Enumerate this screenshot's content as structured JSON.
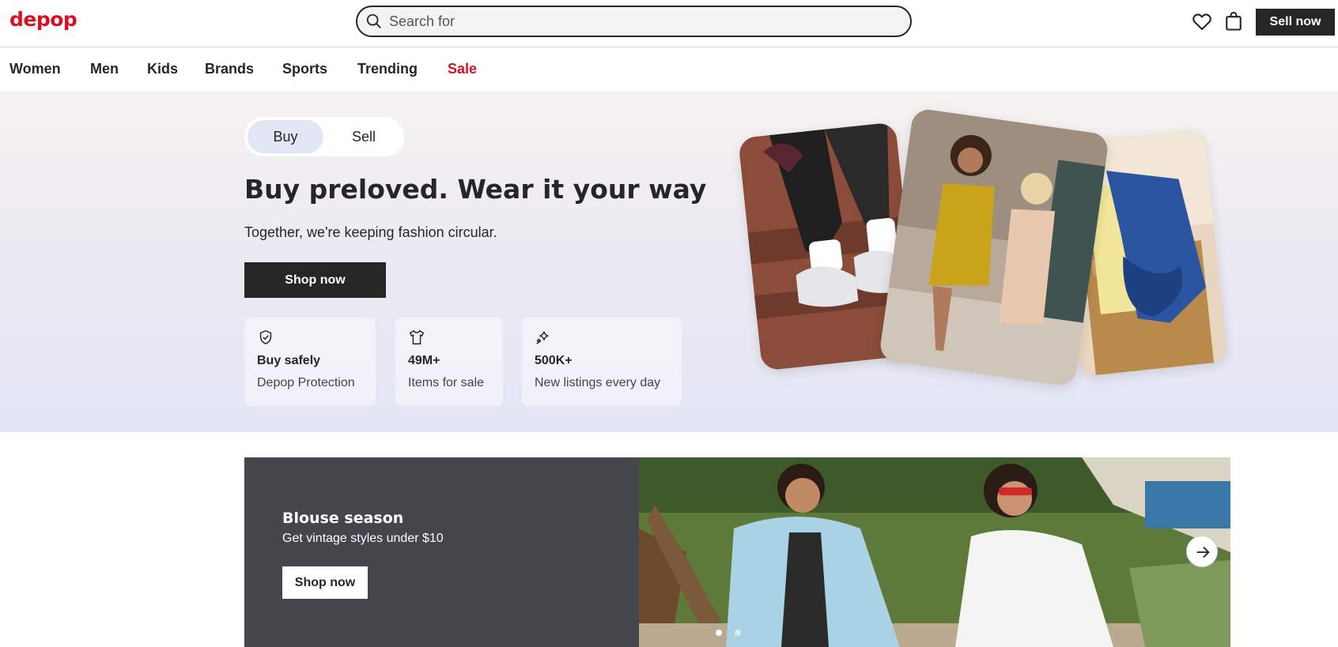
{
  "header": {
    "logo": "depop",
    "search_placeholder": "Search for",
    "sell_label": "Sell now",
    "icons": [
      "heart-icon",
      "shopping-bag-icon",
      "search-icon"
    ]
  },
  "nav": {
    "items": [
      "Women",
      "Men",
      "Kids",
      "Brands",
      "Sports",
      "Trending",
      "Sale"
    ]
  },
  "hero": {
    "toggle": {
      "buy": "Buy",
      "sell": "Sell",
      "selected": "Buy"
    },
    "title": "Buy preloved. Wear it your way",
    "subtitle": "Together, we're keeping fashion circular.",
    "cta": "Shop now",
    "stats": [
      {
        "icon": "shield-check-icon",
        "value": "Buy safely",
        "label": "Depop Protection"
      },
      {
        "icon": "tshirt-icon",
        "value": "49M+",
        "label": "Items for sale"
      },
      {
        "icon": "sparkles-icon",
        "value": "500K+",
        "label": "New listings every day"
      }
    ]
  },
  "promo": {
    "title": "Blouse season",
    "subtitle": "Get vintage styles under $10",
    "cta": "Shop now",
    "carousel_slides": 2,
    "active_slide": 1
  },
  "colors": {
    "brand": "#d90f24",
    "dark": "#262626",
    "promo_bg": "#44464c"
  }
}
